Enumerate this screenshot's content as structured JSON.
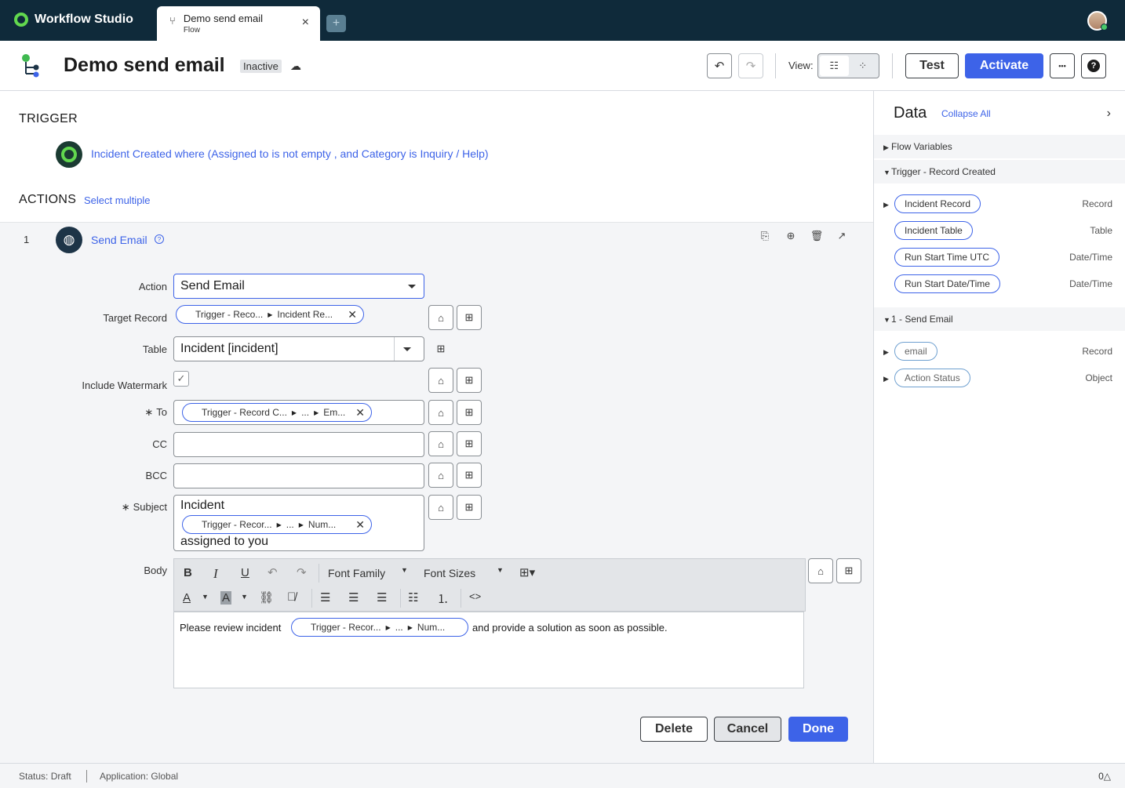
{
  "app": {
    "name": "Workflow Studio"
  },
  "tab": {
    "title": "Demo send email",
    "subtitle": "Flow",
    "close": "×",
    "add": "+"
  },
  "header": {
    "title": "Demo send email",
    "status": "Inactive",
    "view_label": "View:",
    "test_label": "Test",
    "activate_label": "Activate",
    "more_label": "•••",
    "help_label": "?"
  },
  "trigger": {
    "heading": "TRIGGER",
    "description": "Incident Created where (Assigned to is not empty , and Category is Inquiry / Help)"
  },
  "actions": {
    "heading": "ACTIONS",
    "select_multiple": "Select multiple",
    "step": {
      "number": "1",
      "title": "Send Email",
      "fields": {
        "action": {
          "label": "Action",
          "value": "Send Email"
        },
        "target_record": {
          "label": "Target Record",
          "pill_a": "Trigger - Reco...",
          "pill_b": "Incident Re..."
        },
        "table": {
          "label": "Table",
          "value": "Incident [incident]"
        },
        "include_watermark": {
          "label": "Include Watermark",
          "checked": true
        },
        "to": {
          "label": "To",
          "pill_a": "Trigger - Record C...",
          "pill_mid": "...",
          "pill_b": "Em..."
        },
        "cc": {
          "label": "CC",
          "value": ""
        },
        "bcc": {
          "label": "BCC",
          "value": ""
        },
        "subject": {
          "label": "Subject",
          "line1": "Incident",
          "pill_a": "Trigger - Recor...",
          "pill_mid": "...",
          "pill_b": "Num...",
          "line2": "assigned to you"
        },
        "body": {
          "label": "Body",
          "font_family": "Font Family",
          "font_sizes": "Font Sizes",
          "text_before": "Please review incident",
          "pill_a": "Trigger - Recor...",
          "pill_mid": "...",
          "pill_b": "Num...",
          "text_after": "and provide a solution as soon as possible."
        }
      },
      "buttons": {
        "delete": "Delete",
        "cancel": "Cancel",
        "done": "Done"
      }
    }
  },
  "data_panel": {
    "title": "Data",
    "collapse_all": "Collapse All",
    "groups": [
      {
        "label": "Flow Variables"
      },
      {
        "label": "Trigger - Record Created"
      },
      {
        "label": "1 - Send Email"
      }
    ],
    "trigger_items": [
      {
        "name": "Incident Record",
        "type": "Record"
      },
      {
        "name": "Incident Table",
        "type": "Table"
      },
      {
        "name": "Run Start Time UTC",
        "type": "Date/Time"
      },
      {
        "name": "Run Start Date/Time",
        "type": "Date/Time"
      }
    ],
    "send_email_items": [
      {
        "name": "email",
        "type": "Record"
      },
      {
        "name": "Action Status",
        "type": "Object"
      }
    ]
  },
  "footer": {
    "status": "Status: Draft",
    "application": "Application: Global",
    "notifications": "0"
  },
  "colors": {
    "accent": "#3d63e8",
    "topbar": "#0f2a3a",
    "brand_green": "#62d84e"
  }
}
